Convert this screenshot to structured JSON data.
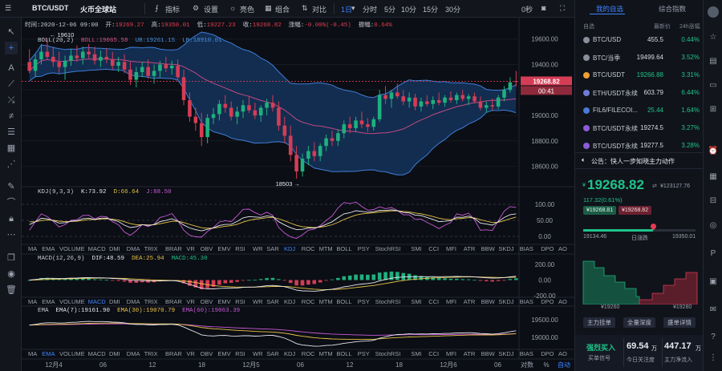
{
  "toolbar": {
    "symbol": "BTC/USDT",
    "exchange": "火币全球站",
    "indicators": "指标",
    "settings": "设置",
    "theme": "亮色",
    "combine": "组合",
    "compare": "对比",
    "intervals": [
      "1日",
      "分时",
      "5分",
      "10分",
      "15分",
      "30分"
    ],
    "selected_interval": "1日",
    "countdown": "0秒"
  },
  "ohlc": {
    "time_label": "时间:",
    "time": "2020-12-06 09:00",
    "open_label": "开:",
    "open": "19269.27",
    "high_label": "高:",
    "high": "19350.01",
    "low_label": "低:",
    "low": "19227.23",
    "close_label": "收:",
    "close": "19268.82",
    "change_label": "涨幅:",
    "change": "-0.00%(-0.45)",
    "amp_label": "振幅:",
    "amp": "0.64%"
  },
  "boll": {
    "name": "BOLL(20,2)",
    "ub": "UB:19261.15",
    "mb": "BOLL:19065.58",
    "lb": "LB:18910.01"
  },
  "kdj": {
    "name": "KDJ(9,3,3)",
    "k": "K:73.92",
    "d": "D:66.64",
    "j": "J:88.50"
  },
  "macd": {
    "name": "MACD(12,26,9)",
    "dif": "DIF:48.59",
    "dea": "DEA:25.94",
    "macd": "MACD:45.30"
  },
  "ema": {
    "name": "EMA",
    "e7": "EMA(7):19161.90",
    "e30": "EMA(30):19070.79",
    "e60": "EMA(60):19063.39"
  },
  "indicator_tabs": [
    "MA",
    "EMA",
    "VOLUME",
    "MACD",
    "DMI",
    "DMA",
    "TRIX",
    "BRAR",
    "VR",
    "OBV",
    "EMV",
    "RSI",
    "WR",
    "SAR",
    "KDJ",
    "ROC",
    "MTM",
    "BOLL",
    "PSY",
    "StochRSI",
    "SMI",
    "CCI",
    "MFI",
    "ATR",
    "BBW",
    "SKDJ",
    "BIAS",
    "DPO",
    "AO"
  ],
  "tabs_sel": {
    "row1": "KDJ",
    "row2": "MACD",
    "row3": "EMA"
  },
  "price_axis": [
    "19600.00",
    "19400.00",
    "19200.00",
    "19000.00",
    "18800.00",
    "18600.00"
  ],
  "kdj_axis": [
    "100.00",
    "50.00",
    "0.00"
  ],
  "macd_axis": [
    "200.00",
    "0.00",
    "-200.00"
  ],
  "ema_axis": [
    "19500.00",
    "19000.00"
  ],
  "time_axis": [
    "12月4",
    "06",
    "12",
    "18",
    "12月5",
    "06",
    "12",
    "18",
    "12月6",
    "06"
  ],
  "axis_controls": {
    "log": "对数",
    "pct": "%",
    "auto": "自动"
  },
  "current_price_tag": "19268.82",
  "countdown_tag": "00:41",
  "annot_high": "19610",
  "annot_low": "18503",
  "right_panel": {
    "tabs": [
      "我的自选",
      "综合指数"
    ],
    "tab_selected": "我的自选",
    "header": {
      "name": "自选",
      "price": "最新价",
      "change": "24h涨幅"
    },
    "watchlist": [
      {
        "icon_color": "#8a8f9c",
        "name": "BTC/USD",
        "price": "455.5",
        "change": "0.44%"
      },
      {
        "icon_color": "#8a8f9c",
        "name": "BTC/当季",
        "price": "19499.64",
        "change": "3.52%"
      },
      {
        "icon_color": "#f0a030",
        "name": "BTC/USDT",
        "price": "19266.88",
        "change": "3.31%",
        "price_green": true
      },
      {
        "icon_color": "#6f7bd6",
        "name": "ETH/USDT永续",
        "price": "603.79",
        "change": "6.44%"
      },
      {
        "icon_color": "#4b79d6",
        "name": "FIL6/FILECOI...",
        "price": "25.44",
        "change": "1.64%",
        "price_green": true
      },
      {
        "icon_color": "#8a5cd6",
        "name": "BTC/USDT永续",
        "price": "19274.5",
        "change": "3.27%"
      },
      {
        "icon_color": "#8a5cd6",
        "name": "BTC/USDT永续",
        "price": "19277.5",
        "change": "3.28%"
      }
    ],
    "announcement": "公告：快人一步知晓主力动作",
    "big_price": "19268.82",
    "price_prefix": "¥",
    "vol_label": "¥123127.76",
    "change_line": "117.32(0.61%)",
    "bid_pill": "¥19268.81",
    "ask_pill": "¥19268.82",
    "range_low": "19134.46",
    "range_high": "19350.01",
    "range_label": "日涨跌",
    "range_fraction": 0.62,
    "depth_x_left": "¥19260",
    "depth_x_right": "¥19280",
    "buttons": [
      "主力挂单",
      "全量深度",
      "盛单详情"
    ],
    "bottom": {
      "buy_label": "强烈买入",
      "buy_sub": "买单信号",
      "inflow_value": "69.54",
      "inflow_unit": "万",
      "inflow_label": "今日关注度",
      "net_value": "447.17",
      "net_unit": "万",
      "net_label": "主力净流入"
    }
  },
  "chart_data": [
    {
      "type": "candlestick",
      "title": "BTC/USDT",
      "x_ticks": [
        "12月4",
        "06",
        "12",
        "18",
        "12月5",
        "06",
        "12",
        "18",
        "12月6",
        "06"
      ],
      "ylim": [
        18440,
        19680
      ],
      "candles": [
        {
          "o": 19420,
          "h": 19520,
          "l": 19330,
          "c": 19350
        },
        {
          "o": 19350,
          "h": 19480,
          "l": 19300,
          "c": 19440
        },
        {
          "o": 19440,
          "h": 19560,
          "l": 19400,
          "c": 19500
        },
        {
          "o": 19500,
          "h": 19610,
          "l": 19440,
          "c": 19460
        },
        {
          "o": 19460,
          "h": 19540,
          "l": 19380,
          "c": 19420
        },
        {
          "o": 19420,
          "h": 19500,
          "l": 19330,
          "c": 19380
        },
        {
          "o": 19380,
          "h": 19470,
          "l": 19280,
          "c": 19430
        },
        {
          "o": 19430,
          "h": 19520,
          "l": 19390,
          "c": 19470
        },
        {
          "o": 19470,
          "h": 19550,
          "l": 19420,
          "c": 19450
        },
        {
          "o": 19450,
          "h": 19540,
          "l": 19400,
          "c": 19500
        },
        {
          "o": 19500,
          "h": 19560,
          "l": 19450,
          "c": 19480
        },
        {
          "o": 19480,
          "h": 19540,
          "l": 19400,
          "c": 19430
        },
        {
          "o": 19430,
          "h": 19510,
          "l": 19380,
          "c": 19460
        },
        {
          "o": 19460,
          "h": 19530,
          "l": 19410,
          "c": 19440
        },
        {
          "o": 19440,
          "h": 19500,
          "l": 19360,
          "c": 19390
        },
        {
          "o": 19390,
          "h": 19460,
          "l": 19340,
          "c": 19420
        },
        {
          "o": 19420,
          "h": 19480,
          "l": 19330,
          "c": 19360
        },
        {
          "o": 19360,
          "h": 19420,
          "l": 19240,
          "c": 19280
        },
        {
          "o": 19280,
          "h": 19380,
          "l": 19220,
          "c": 19340
        },
        {
          "o": 19340,
          "h": 19420,
          "l": 19300,
          "c": 19380
        },
        {
          "o": 19380,
          "h": 19440,
          "l": 19290,
          "c": 19310
        },
        {
          "o": 19310,
          "h": 19400,
          "l": 19250,
          "c": 19350
        },
        {
          "o": 19350,
          "h": 19430,
          "l": 19300,
          "c": 19400
        },
        {
          "o": 19400,
          "h": 19460,
          "l": 19340,
          "c": 19370
        },
        {
          "o": 19370,
          "h": 19430,
          "l": 19320,
          "c": 19390
        },
        {
          "o": 19390,
          "h": 19440,
          "l": 19280,
          "c": 19300
        },
        {
          "o": 19300,
          "h": 19360,
          "l": 19080,
          "c": 19120
        },
        {
          "o": 19120,
          "h": 19180,
          "l": 18950,
          "c": 18990
        },
        {
          "o": 18990,
          "h": 19060,
          "l": 18880,
          "c": 18940
        },
        {
          "o": 18940,
          "h": 19020,
          "l": 18760,
          "c": 18830
        },
        {
          "o": 18830,
          "h": 19010,
          "l": 18780,
          "c": 18980
        },
        {
          "o": 18980,
          "h": 19060,
          "l": 18930,
          "c": 19010
        },
        {
          "o": 19010,
          "h": 19120,
          "l": 18960,
          "c": 19090
        },
        {
          "o": 19090,
          "h": 19160,
          "l": 19020,
          "c": 19060
        },
        {
          "o": 19060,
          "h": 19110,
          "l": 18960,
          "c": 18990
        },
        {
          "o": 18990,
          "h": 19070,
          "l": 18930,
          "c": 19030
        },
        {
          "o": 19030,
          "h": 19120,
          "l": 18980,
          "c": 19080
        },
        {
          "o": 19080,
          "h": 19150,
          "l": 19020,
          "c": 19040
        },
        {
          "o": 19040,
          "h": 19100,
          "l": 18970,
          "c": 19000
        },
        {
          "o": 19000,
          "h": 19080,
          "l": 18950,
          "c": 19060
        },
        {
          "o": 19060,
          "h": 19130,
          "l": 19000,
          "c": 19100
        },
        {
          "o": 19100,
          "h": 19160,
          "l": 19030,
          "c": 19060
        },
        {
          "o": 19060,
          "h": 19110,
          "l": 18880,
          "c": 18920
        },
        {
          "o": 18920,
          "h": 18990,
          "l": 18780,
          "c": 18840
        },
        {
          "o": 18840,
          "h": 18920,
          "l": 18640,
          "c": 18690
        },
        {
          "o": 18690,
          "h": 18760,
          "l": 18503,
          "c": 18560
        },
        {
          "o": 18560,
          "h": 18700,
          "l": 18520,
          "c": 18660
        },
        {
          "o": 18660,
          "h": 18760,
          "l": 18610,
          "c": 18720
        },
        {
          "o": 18720,
          "h": 18790,
          "l": 18640,
          "c": 18680
        },
        {
          "o": 18680,
          "h": 18780,
          "l": 18640,
          "c": 18760
        },
        {
          "o": 18760,
          "h": 18850,
          "l": 18720,
          "c": 18820
        },
        {
          "o": 18820,
          "h": 18880,
          "l": 18760,
          "c": 18800
        },
        {
          "o": 18800,
          "h": 18890,
          "l": 18760,
          "c": 18860
        },
        {
          "o": 18860,
          "h": 18960,
          "l": 18820,
          "c": 18930
        },
        {
          "o": 18930,
          "h": 18990,
          "l": 18860,
          "c": 18900
        },
        {
          "o": 18900,
          "h": 18990,
          "l": 18870,
          "c": 18960
        },
        {
          "o": 18960,
          "h": 19030,
          "l": 18900,
          "c": 18930
        },
        {
          "o": 18930,
          "h": 18980,
          "l": 18870,
          "c": 18910
        },
        {
          "o": 18910,
          "h": 18990,
          "l": 18880,
          "c": 18970
        },
        {
          "o": 18970,
          "h": 19200,
          "l": 18950,
          "c": 19160
        },
        {
          "o": 19160,
          "h": 19230,
          "l": 19090,
          "c": 19130
        },
        {
          "o": 19130,
          "h": 19200,
          "l": 19060,
          "c": 19180
        },
        {
          "o": 19180,
          "h": 19250,
          "l": 19130,
          "c": 19150
        },
        {
          "o": 19150,
          "h": 19200,
          "l": 19080,
          "c": 19110
        },
        {
          "o": 19110,
          "h": 19180,
          "l": 19060,
          "c": 19140
        },
        {
          "o": 19140,
          "h": 19170,
          "l": 19040,
          "c": 19070
        },
        {
          "o": 19070,
          "h": 19140,
          "l": 19030,
          "c": 19110
        },
        {
          "o": 19110,
          "h": 19160,
          "l": 19070,
          "c": 19090
        },
        {
          "o": 19090,
          "h": 19150,
          "l": 19050,
          "c": 19120
        },
        {
          "o": 19120,
          "h": 19180,
          "l": 19080,
          "c": 19100
        },
        {
          "o": 19100,
          "h": 19160,
          "l": 19070,
          "c": 19140
        },
        {
          "o": 19140,
          "h": 19190,
          "l": 19100,
          "c": 19120
        },
        {
          "o": 19120,
          "h": 19180,
          "l": 19090,
          "c": 19160
        },
        {
          "o": 19160,
          "h": 19200,
          "l": 19110,
          "c": 19130
        },
        {
          "o": 19130,
          "h": 19170,
          "l": 19080,
          "c": 19150
        },
        {
          "o": 19150,
          "h": 19180,
          "l": 19100,
          "c": 19110
        },
        {
          "o": 19110,
          "h": 19150,
          "l": 19040,
          "c": 19060
        },
        {
          "o": 19060,
          "h": 19110,
          "l": 19020,
          "c": 19080
        },
        {
          "o": 19080,
          "h": 19130,
          "l": 19040,
          "c": 19070
        },
        {
          "o": 19070,
          "h": 19160,
          "l": 19050,
          "c": 19140
        },
        {
          "o": 19140,
          "h": 19230,
          "l": 19110,
          "c": 19200
        },
        {
          "o": 19200,
          "h": 19300,
          "l": 19180,
          "c": 19260
        },
        {
          "o": 19269,
          "h": 19350,
          "l": 19227,
          "c": 19268
        }
      ]
    }
  ]
}
